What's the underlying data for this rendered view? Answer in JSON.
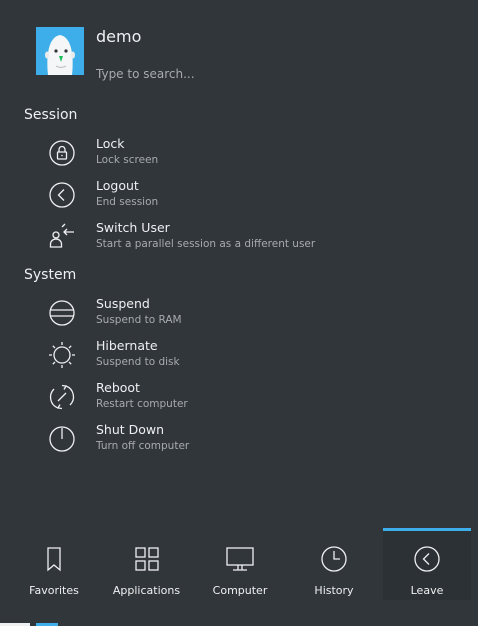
{
  "user": {
    "name": "demo",
    "avatar_icon": "user-avatar-face"
  },
  "search": {
    "placeholder": "Type to search..."
  },
  "sections": {
    "session": {
      "title": "Session",
      "items": [
        {
          "title": "Lock",
          "subtitle": "Lock screen",
          "icon": "lock-icon"
        },
        {
          "title": "Logout",
          "subtitle": "End session",
          "icon": "logout-icon"
        },
        {
          "title": "Switch User",
          "subtitle": "Start a parallel session as a different user",
          "icon": "switch-user-icon"
        }
      ]
    },
    "system": {
      "title": "System",
      "items": [
        {
          "title": "Suspend",
          "subtitle": "Suspend to RAM",
          "icon": "suspend-icon"
        },
        {
          "title": "Hibernate",
          "subtitle": "Suspend to disk",
          "icon": "hibernate-icon"
        },
        {
          "title": "Reboot",
          "subtitle": "Restart computer",
          "icon": "reboot-icon"
        },
        {
          "title": "Shut Down",
          "subtitle": "Turn off computer",
          "icon": "shutdown-icon"
        }
      ]
    }
  },
  "tabs": [
    {
      "label": "Favorites",
      "icon": "bookmark-icon"
    },
    {
      "label": "Applications",
      "icon": "grid-icon"
    },
    {
      "label": "Computer",
      "icon": "monitor-icon"
    },
    {
      "label": "History",
      "icon": "clock-icon"
    },
    {
      "label": "Leave",
      "icon": "back-circle-icon",
      "active": true
    }
  ],
  "colors": {
    "background": "#31363b",
    "accent": "#3daee9",
    "text": "#eff0f1",
    "subtext": "#a8abad"
  }
}
